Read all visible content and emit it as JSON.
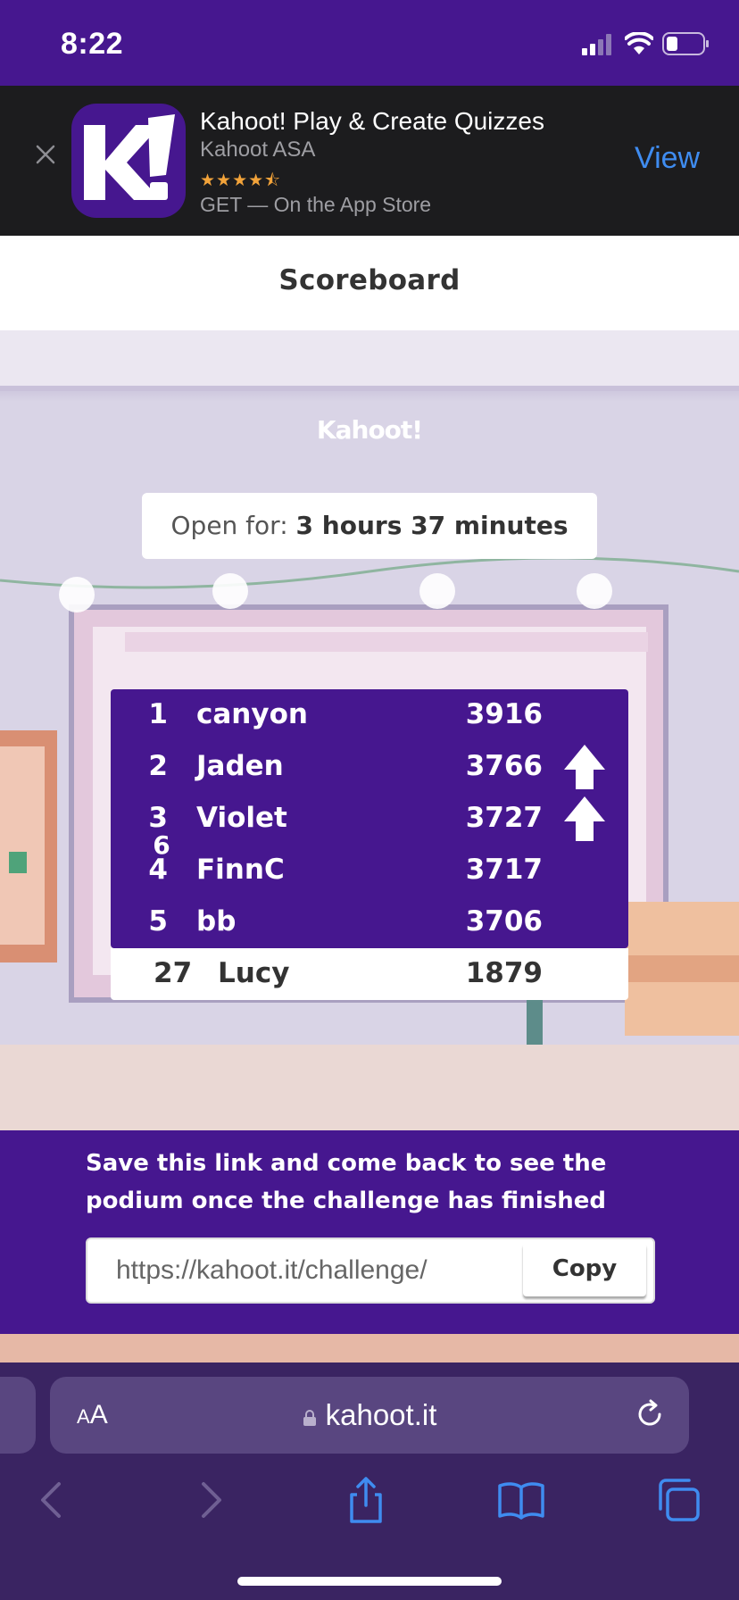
{
  "status_bar": {
    "time": "8:22"
  },
  "app_banner": {
    "app_name": "Kahoot! Play & Create Quizzes",
    "developer": "Kahoot ASA",
    "rating_stars": "★★★★⯪",
    "get_label": "GET — On the App Store",
    "view_label": "View",
    "icon_text": "K!"
  },
  "page": {
    "title": "Scoreboard"
  },
  "scene": {
    "logo": "Kahoot!",
    "open_for_label": "Open for:",
    "open_for_value": "3 hours 37 minutes"
  },
  "leaderboard": {
    "rows": [
      {
        "rank": "1",
        "name": "canyon",
        "score": "3916",
        "moved_up": false
      },
      {
        "rank": "2",
        "name": "Jaden",
        "score": "3766",
        "moved_up": true
      },
      {
        "rank": "3",
        "name": "Violet",
        "score": "3727",
        "moved_up": true
      },
      {
        "rank": "4",
        "name": "FinnC",
        "score": "3717",
        "moved_up": false
      },
      {
        "rank": "5",
        "name": "bb",
        "score": "3706",
        "moved_up": false
      }
    ],
    "transition_rank": "6",
    "player": {
      "rank": "27",
      "name": "Lucy",
      "score": "1879"
    }
  },
  "save_panel": {
    "message": "Save this link and come back to see the podium once the challenge has finished",
    "link": "https://kahoot.it/challenge/",
    "copy_label": "Copy"
  },
  "safari": {
    "aa_label_small": "A",
    "aa_label_large": "A",
    "host": "kahoot.it"
  },
  "colors": {
    "brand_purple": "#46178f",
    "banner_bg": "#1c1c1e",
    "link_blue": "#3f8cf0",
    "star_orange": "#f2a33a"
  }
}
